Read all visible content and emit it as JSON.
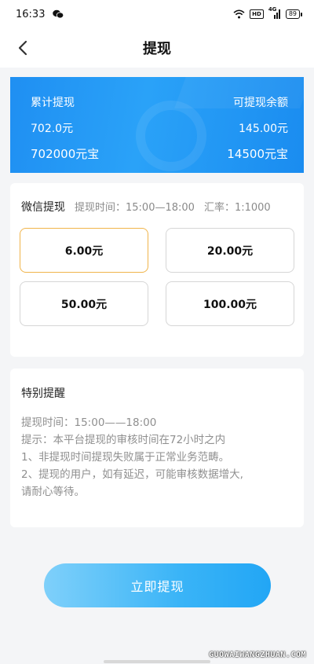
{
  "status_bar": {
    "time": "16:33",
    "signal_label": "4G",
    "hd_label": "HD",
    "battery": "89"
  },
  "nav": {
    "title": "提现"
  },
  "balance_card": {
    "total_label": "累计提现",
    "total_yuan": "702.0元",
    "total_bao": "702000元宝",
    "available_label": "可提现余额",
    "available_yuan": "145.00元",
    "available_bao": "14500元宝"
  },
  "withdraw": {
    "method": "微信提现",
    "time": "提现时间：15:00—18:00",
    "rate": "汇率：1:1000",
    "amounts": [
      {
        "label": "6.00元",
        "selected": true
      },
      {
        "label": "20.00元",
        "selected": false
      },
      {
        "label": "50.00元",
        "selected": false
      },
      {
        "label": "100.00元",
        "selected": false
      }
    ]
  },
  "notice": {
    "title": "特别提醒",
    "lines": [
      "提现时间：15:00——18:00",
      "提示：本平台提现的审核时间在72小时之内",
      "1、非提现时间提现失败属于正常业务范畴。",
      "2、提现的用户，如有延迟，可能审核数据增大,",
      "请耐心等待。"
    ]
  },
  "submit": {
    "label": "立即提现"
  },
  "watermark": "GUOWAIWANGZHUAN.COM",
  "colors": {
    "card_blue": "#1f8ff2",
    "selected_border": "#f0b44a",
    "button_blue": "#3ab4f7"
  }
}
